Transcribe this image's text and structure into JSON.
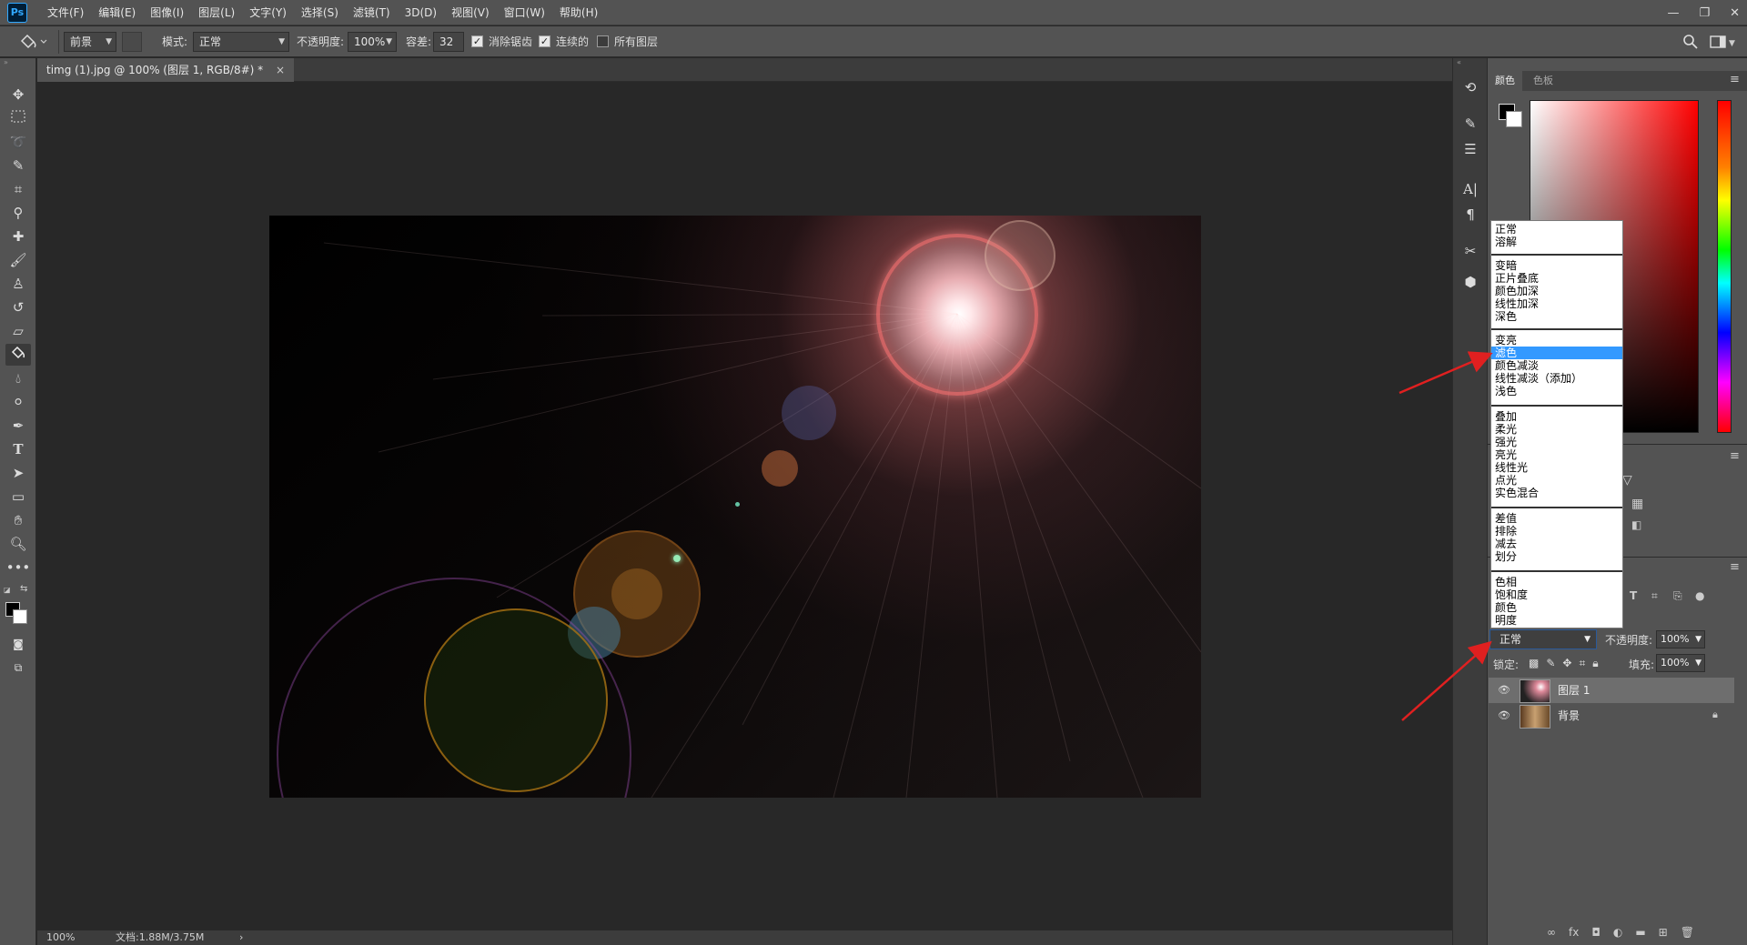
{
  "menubar": {
    "logo": "Ps",
    "items": [
      "文件(F)",
      "编辑(E)",
      "图像(I)",
      "图层(L)",
      "文字(Y)",
      "选择(S)",
      "滤镜(T)",
      "3D(D)",
      "视图(V)",
      "窗口(W)",
      "帮助(H)"
    ],
    "window_controls": [
      "—",
      "❐",
      "✕"
    ]
  },
  "options_bar": {
    "fill_source": "前景",
    "mode_label": "模式:",
    "mode_value": "正常",
    "opacity_label": "不透明度:",
    "opacity_value": "100%",
    "tolerance_label": "容差:",
    "tolerance_value": "32",
    "antialias_label": "消除锯齿",
    "antialias_checked": true,
    "contiguous_label": "连续的",
    "contiguous_checked": true,
    "all_layers_label": "所有图层",
    "all_layers_checked": false
  },
  "document": {
    "tab_title": "timg (1).jpg @ 100% (图层 1, RGB/8#) *",
    "tab_close": "×"
  },
  "status_bar": {
    "zoom": "100%",
    "doc_info": "文档:1.88M/3.75M",
    "arrow": "›"
  },
  "color_panel": {
    "tabs": [
      "颜色",
      "色板"
    ],
    "foreground_color": "#000000",
    "background_color": "#ffffff"
  },
  "layers_panel": {
    "blend_mode": "正常",
    "opacity_label": "不透明度:",
    "opacity_value": "100%",
    "lock_label": "锁定:",
    "fill_label": "填充:",
    "fill_value": "100%",
    "layers": [
      {
        "name": "图层 1",
        "selected": true,
        "locked": false
      },
      {
        "name": "背景",
        "selected": false,
        "locked": true
      }
    ],
    "footer_icons": [
      "link-icon",
      "fx-icon",
      "mask-icon",
      "adjustment-icon",
      "folder-icon",
      "new-layer-icon",
      "trash-icon"
    ]
  },
  "blend_list": {
    "groups": [
      [
        "正常",
        "溶解"
      ],
      [
        "变暗",
        "正片叠底",
        "颜色加深",
        "线性加深",
        "深色"
      ],
      [
        "变亮",
        "滤色",
        "颜色减淡",
        "线性减淡（添加）",
        "浅色"
      ],
      [
        "叠加",
        "柔光",
        "强光",
        "亮光",
        "线性光",
        "点光",
        "实色混合"
      ],
      [
        "差值",
        "排除",
        "减去",
        "划分"
      ],
      [
        "色相",
        "饱和度",
        "颜色",
        "明度"
      ]
    ],
    "highlighted": "滤色"
  },
  "annotation_color": "#e02020"
}
